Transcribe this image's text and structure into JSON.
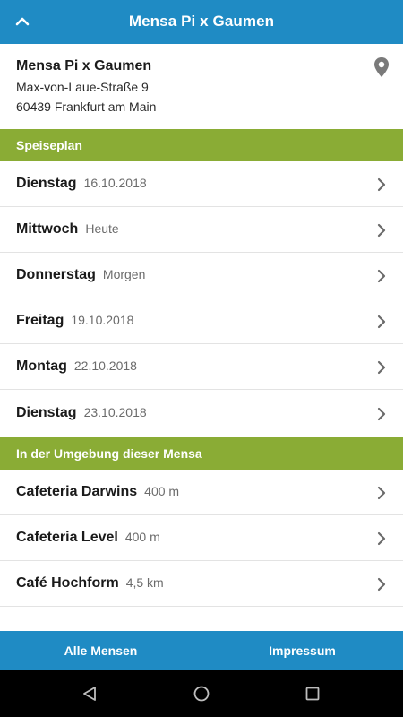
{
  "header": {
    "title": "Mensa Pi x Gaumen",
    "back_icon": "chevron-up-icon"
  },
  "mensa": {
    "name": "Mensa Pi x Gaumen",
    "street": "Max-von-Laue-Straße 9",
    "city": "60439 Frankfurt am Main",
    "location_icon": "map-pin-icon"
  },
  "speiseplan": {
    "title": "Speiseplan",
    "days": [
      {
        "day": "Dienstag",
        "date": "16.10.2018"
      },
      {
        "day": "Mittwoch",
        "date": "Heute"
      },
      {
        "day": "Donnerstag",
        "date": "Morgen"
      },
      {
        "day": "Freitag",
        "date": "19.10.2018"
      },
      {
        "day": "Montag",
        "date": "22.10.2018"
      },
      {
        "day": "Dienstag",
        "date": "23.10.2018"
      }
    ]
  },
  "nearby": {
    "title": "In der Umgebung dieser Mensa",
    "places": [
      {
        "name": "Cafeteria Darwins",
        "distance": "400 m"
      },
      {
        "name": "Cafeteria Level",
        "distance": "400 m"
      },
      {
        "name": "Café Hochform",
        "distance": "4,5 km"
      }
    ]
  },
  "bottom_bar": {
    "left_label": "Alle Mensen",
    "right_label": "Impressum"
  },
  "system_nav": {
    "back_icon": "triangle-back-icon",
    "home_icon": "circle-home-icon",
    "recents_icon": "square-recents-icon"
  },
  "colors": {
    "primary": "#1f8bc4",
    "section": "#8aac35",
    "nav_bar": "#000000"
  }
}
